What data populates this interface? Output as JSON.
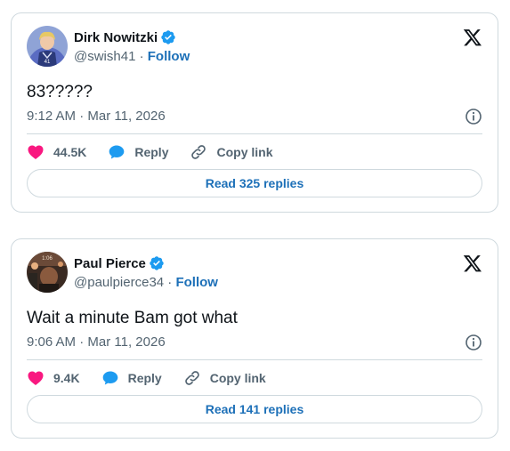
{
  "colors": {
    "brand_blue": "#1d9bf0",
    "link_blue": "#1d70b8",
    "like_red": "#f91880",
    "text_primary": "#0f1419",
    "text_secondary": "#536471",
    "border": "#cfd9de"
  },
  "posts": [
    {
      "author_name": "Dirk Nowitzki",
      "handle": "@swish41",
      "separator": " · ",
      "follow_label": "Follow",
      "text": "83?????",
      "time": "9:12 AM",
      "date_separator": " · ",
      "date": "Mar 11, 2026",
      "likes": "44.5K",
      "reply_label": "Reply",
      "copy_link_label": "Copy link",
      "read_replies_label": "Read 325 replies",
      "icons": [
        "verified-badge-icon",
        "x-logo-icon",
        "info-icon",
        "heart-icon",
        "reply-bubble-icon",
        "link-icon"
      ]
    },
    {
      "author_name": "Paul Pierce",
      "handle": "@paulpierce34",
      "separator": " · ",
      "follow_label": "Follow",
      "text": "Wait a minute Bam got what",
      "time": "9:06 AM",
      "date_separator": " · ",
      "date": "Mar 11, 2026",
      "likes": "9.4K",
      "reply_label": "Reply",
      "copy_link_label": "Copy link",
      "read_replies_label": "Read 141 replies",
      "icons": [
        "verified-badge-icon",
        "x-logo-icon",
        "info-icon",
        "heart-icon",
        "reply-bubble-icon",
        "link-icon"
      ]
    }
  ]
}
